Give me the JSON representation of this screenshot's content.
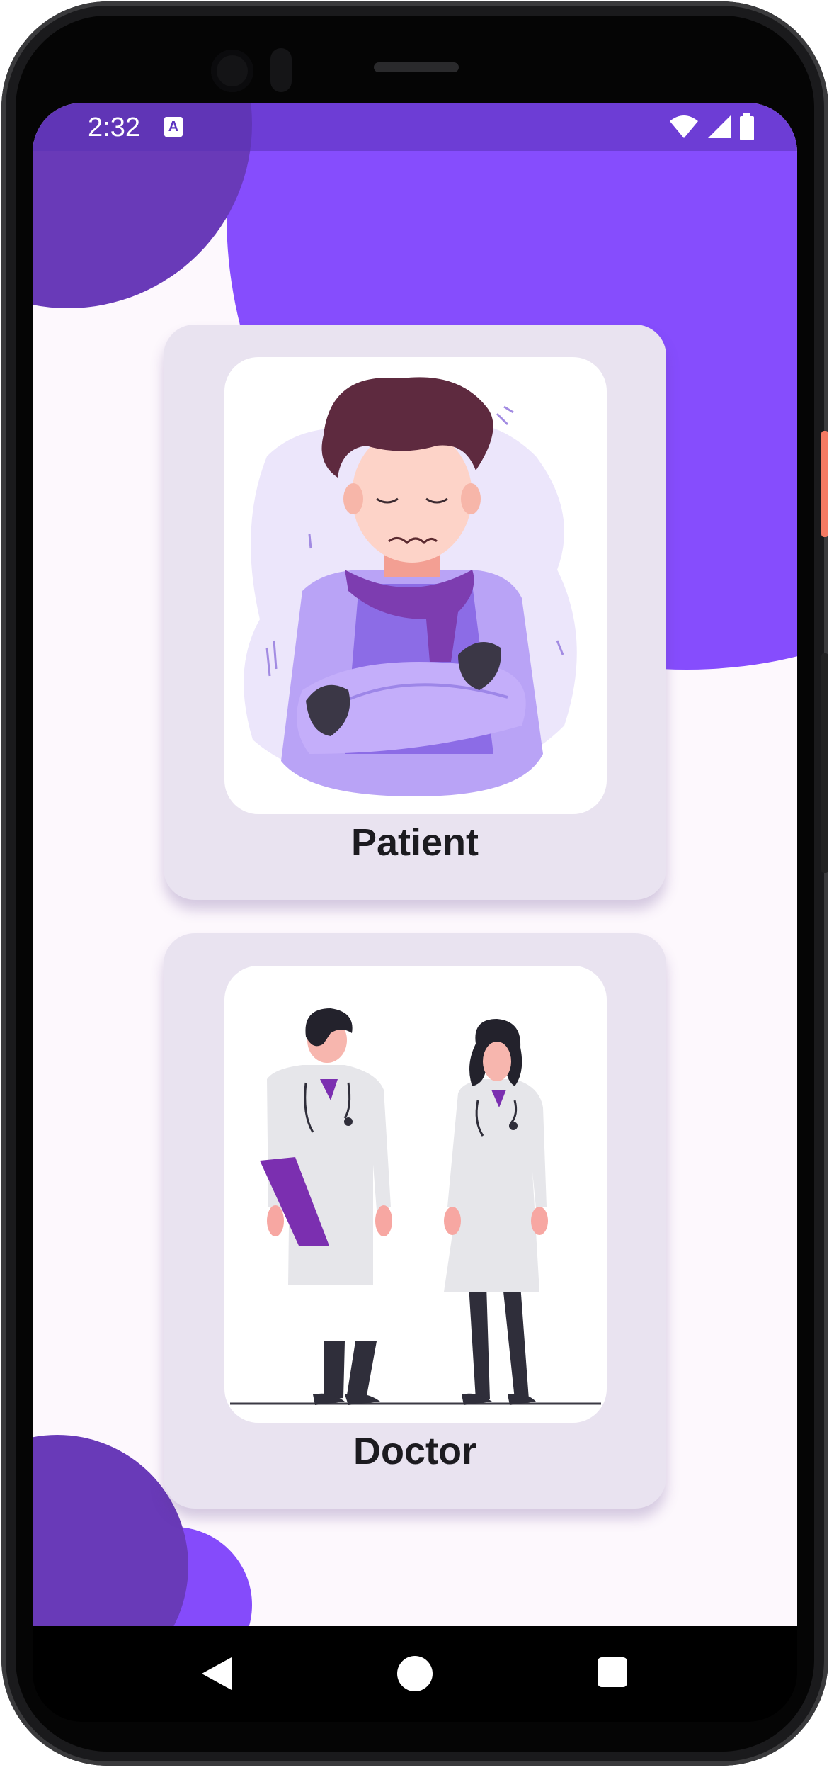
{
  "status_bar": {
    "time": "2:32",
    "notification_icon": "A",
    "icons": [
      "wifi-icon",
      "signal-icon",
      "battery-icon"
    ]
  },
  "cards": {
    "patient": {
      "label": "Patient",
      "illustration": "patient-illustration"
    },
    "doctor": {
      "label": "Doctor",
      "illustration": "doctors-illustration"
    }
  },
  "nav": {
    "back": "back-icon",
    "home": "home-icon",
    "recents": "recents-icon"
  },
  "colors": {
    "accent": "#864dfd",
    "accent_dark": "#693ab8",
    "card_bg": "#e9e3f0",
    "screen_bg": "#fdf8fd"
  }
}
